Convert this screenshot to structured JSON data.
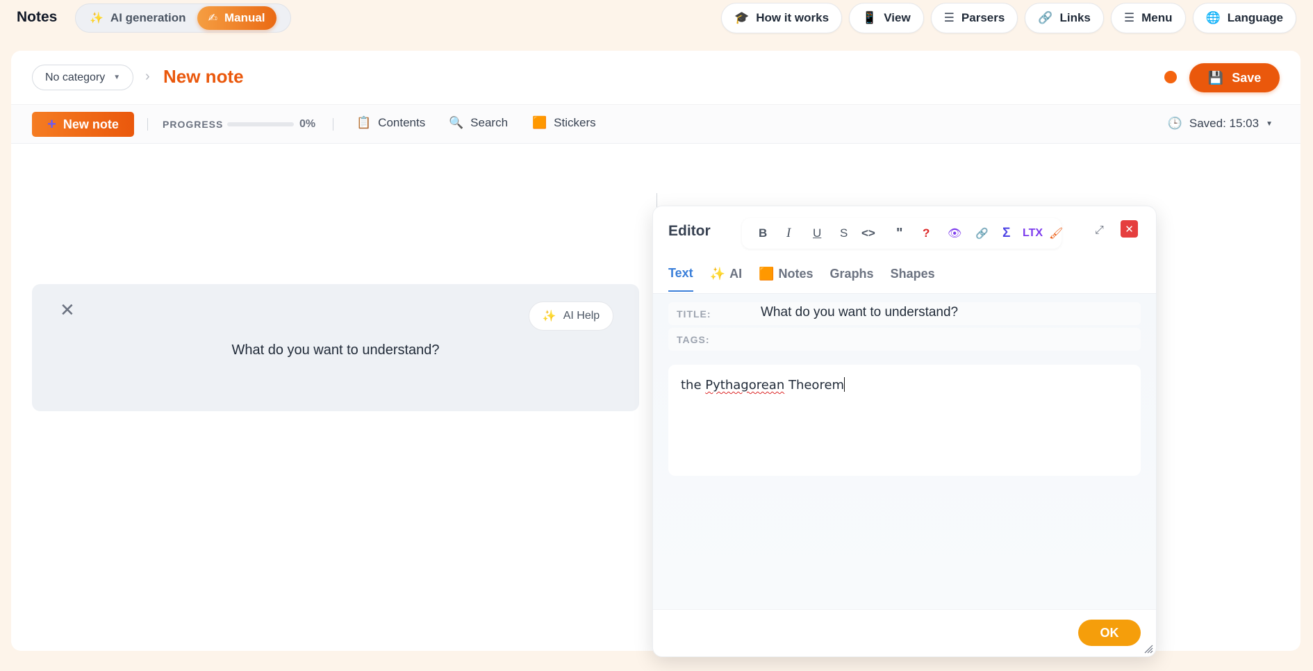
{
  "app": {
    "title": "Notes"
  },
  "mode_switch": {
    "ai_generation": "AI generation",
    "manual": "Manual",
    "active": "manual"
  },
  "top_nav": [
    {
      "label": "How it works",
      "icon": "graduation-cap-icon",
      "glyph": "🎓"
    },
    {
      "label": "View",
      "icon": "phone-icon",
      "glyph": "📱"
    },
    {
      "label": "Parsers",
      "icon": "list-icon",
      "glyph": "☰"
    },
    {
      "label": "Links",
      "icon": "link-icon",
      "glyph": "🔗"
    },
    {
      "label": "Menu",
      "icon": "menu-icon",
      "glyph": "☰"
    },
    {
      "label": "Language",
      "icon": "globe-icon",
      "glyph": "🌐"
    }
  ],
  "header": {
    "category": "No category",
    "title": "New note",
    "save_label": "Save",
    "unsaved_color": "#f4640f"
  },
  "toolbar": {
    "new_note_label": "New note",
    "progress_label": "PROGRESS",
    "progress_value": "0%",
    "progress_fraction": 0,
    "contents_label": "Contents",
    "search_label": "Search",
    "stickers_label": "Stickers",
    "saved_label": "Saved: 15:03"
  },
  "question_card": {
    "ai_help_label": "AI Help",
    "question": "What do you want to understand?"
  },
  "editor": {
    "title": "Editor",
    "format_buttons": {
      "bold": "B",
      "italic": "I",
      "underline": "U",
      "strike": "S",
      "code": "<>",
      "quote": "\"",
      "question": "?",
      "ltx": "LTX"
    },
    "tabs": [
      {
        "label": "Text",
        "active": true
      },
      {
        "label": "AI",
        "icon": "sparkles-icon"
      },
      {
        "label": "Notes",
        "icon": "sticky-note-icon"
      },
      {
        "label": "Graphs"
      },
      {
        "label": "Shapes"
      }
    ],
    "title_label": "TITLE:",
    "title_value": "What do you want to understand?",
    "tags_label": "TAGS:",
    "tags_value": "",
    "text_before": "the ",
    "text_misspelled": "Pythagorean",
    "text_after": " Theorem",
    "ok_label": "OK"
  },
  "colors": {
    "accent": "#ea580c",
    "tab_active": "#3b7fd9",
    "ok": "#f59e0b",
    "close": "#e53e3e"
  }
}
